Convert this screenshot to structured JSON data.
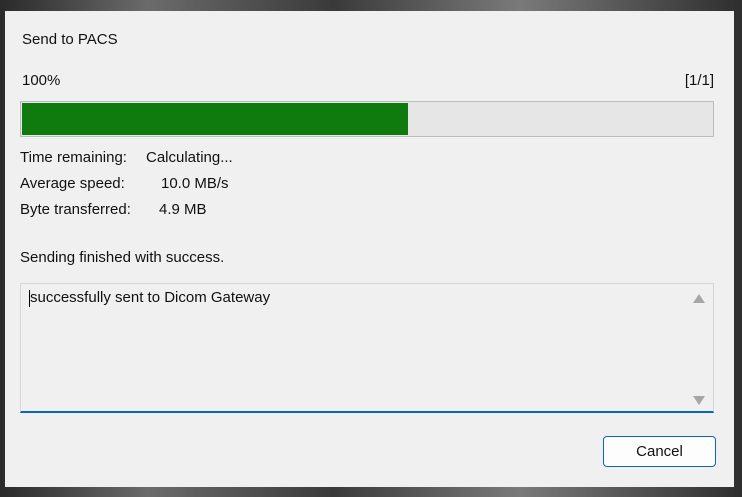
{
  "dialog": {
    "title": "Send to PACS",
    "progress_percent_label": "100%",
    "progress_count": "[1/1]",
    "progress_fill_fraction": 0.56,
    "progress_color": "#0f7b0f",
    "time_remaining_label": "Time remaining:",
    "time_remaining_value": "Calculating...",
    "average_speed_label": "Average speed:",
    "average_speed_value": "10.0 MB/s",
    "bytes_transferred_label": "Byte transferred:",
    "bytes_transferred_value": "4.9 MB",
    "status_message": "Sending finished with success.",
    "log_text": "successfully sent to Dicom Gateway",
    "cancel_label": "Cancel",
    "accent_color": "#0a64c0"
  }
}
